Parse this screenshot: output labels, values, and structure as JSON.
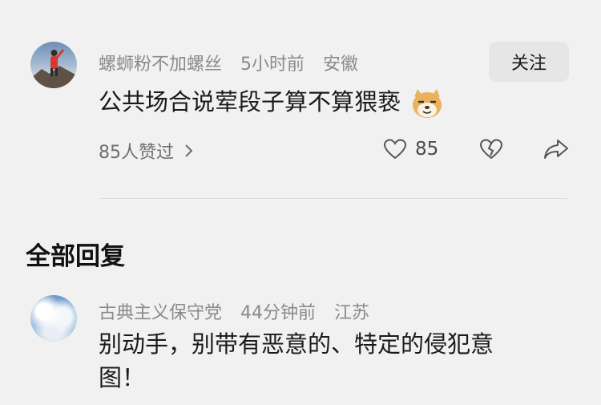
{
  "comment": {
    "username": "螺蛳粉不加螺丝",
    "time": "5小时前",
    "location": "安徽",
    "follow_label": "关注",
    "text": "公共场合说荤段子算不算猥亵",
    "emoji": "doge-emoji",
    "likes_summary": "85人赞过",
    "like_count": "85"
  },
  "section": {
    "title": "全部回复"
  },
  "reply": {
    "username": "古典主义保守党",
    "time": "44分钟前",
    "location": "江苏",
    "text_line1": "别动手，别带有恶意的、特定的侵犯意",
    "text_line2": "图！"
  }
}
